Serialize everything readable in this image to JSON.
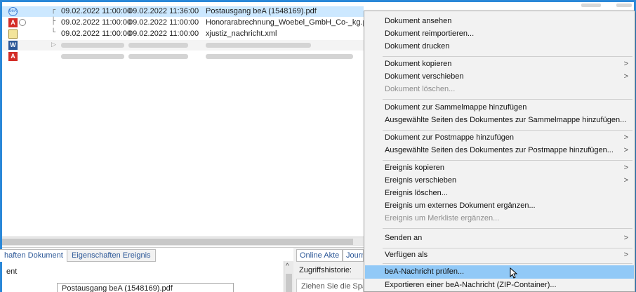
{
  "doclist": {
    "rows": [
      {
        "tree": "┌",
        "date1": "09.02.2022 11:00:00",
        "date2": "09.02.2022 11:36:00",
        "name": "Postausgang beA (1548169).pdf",
        "icon": "bea-icon"
      },
      {
        "tree": "├",
        "date1": "09.02.2022 11:00:00",
        "date2": "09.02.2022 11:00:00",
        "name": "Honorarabrechnung_Woebel_GmbH_Co-_kg.pdf",
        "icon": "pdf-icon"
      },
      {
        "tree": "└",
        "date1": "09.02.2022 11:00:00",
        "date2": "09.02.2022 11:00:00",
        "name": "xjustiz_nachricht.xml",
        "icon": "xml-note-icon"
      }
    ]
  },
  "properties_panel": {
    "tab_document": "haften Dokument",
    "tab_event": "Eigenschaften Ereignis",
    "label": "ent",
    "value": "Postausgang beA (1548169).pdf"
  },
  "akte_panel": {
    "tab_online": "Online Akte",
    "tab_journal": "Journ",
    "access_history": "Zugriffshistorie:",
    "drop_hint": "Ziehen Sie die Spa"
  },
  "context_menu": {
    "items": [
      {
        "label": "Dokument ansehen",
        "submenu": false,
        "disabled": false
      },
      {
        "label": "Dokument reimportieren...",
        "submenu": false,
        "disabled": false
      },
      {
        "label": "Dokument drucken",
        "submenu": false,
        "disabled": false
      },
      {
        "label": "Dokument kopieren",
        "submenu": true,
        "disabled": false
      },
      {
        "label": "Dokument verschieben",
        "submenu": true,
        "disabled": false
      },
      {
        "label": "Dokument löschen...",
        "submenu": false,
        "disabled": true
      },
      {
        "label": "Dokument zur Sammelmappe hinzufügen",
        "submenu": false,
        "disabled": false
      },
      {
        "label": "Ausgewählte Seiten des Dokumentes zur Sammelmappe hinzufügen...",
        "submenu": false,
        "disabled": false
      },
      {
        "label": "Dokument zur Postmappe hinzufügen",
        "submenu": true,
        "disabled": false
      },
      {
        "label": "Ausgewählte Seiten des Dokumentes zur Postmappe hinzufügen...",
        "submenu": true,
        "disabled": false
      },
      {
        "label": "Ereignis kopieren",
        "submenu": true,
        "disabled": false
      },
      {
        "label": "Ereignis verschieben",
        "submenu": true,
        "disabled": false
      },
      {
        "label": "Ereignis löschen...",
        "submenu": false,
        "disabled": false
      },
      {
        "label": "Ereignis um externes Dokument ergänzen...",
        "submenu": false,
        "disabled": false
      },
      {
        "label": "Ereignis um Merkliste ergänzen...",
        "submenu": false,
        "disabled": true
      },
      {
        "label": "Senden an",
        "submenu": true,
        "disabled": false
      },
      {
        "label": "Verfügen als",
        "submenu": true,
        "disabled": false
      },
      {
        "label": "beA-Nachricht prüfen...",
        "submenu": false,
        "disabled": false,
        "highlighted": true
      },
      {
        "label": "Exportieren einer beA-Nachricht (ZIP-Container)...",
        "submenu": false,
        "disabled": false
      }
    ],
    "submenu_arrow": ">"
  },
  "colors": {
    "accent": "#2b88d8",
    "selection": "#cce8ff",
    "menu_highlight": "#91c9f7",
    "menu_bg": "#f2f2f2"
  }
}
